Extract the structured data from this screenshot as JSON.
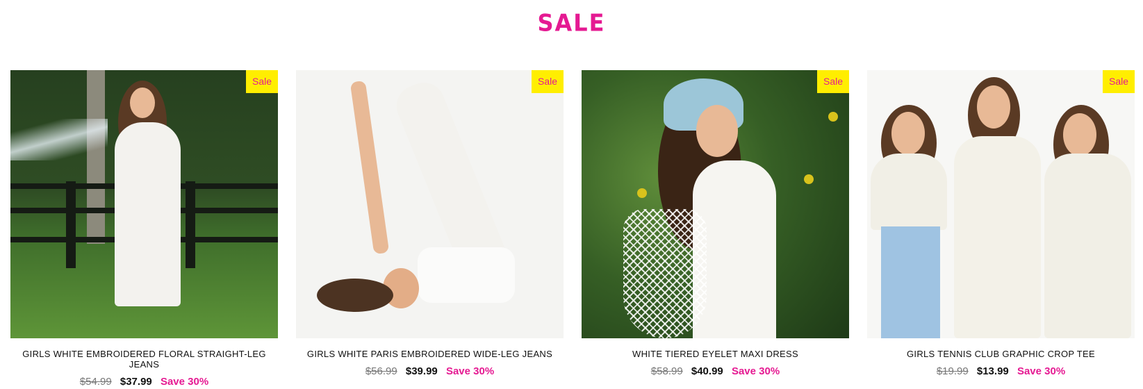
{
  "heading": "SALE",
  "products": [
    {
      "badge": "Sale",
      "name": "GIRLS WHITE EMBROIDERED FLORAL STRAIGHT-LEG JEANS",
      "old_price": "$54.99",
      "new_price": "$37.99",
      "save": "Save 30%"
    },
    {
      "badge": "Sale",
      "name": "GIRLS WHITE PARIS EMBROIDERED WIDE-LEG JEANS",
      "old_price": "$56.99",
      "new_price": "$39.99",
      "save": "Save 30%"
    },
    {
      "badge": "Sale",
      "name": "WHITE TIERED EYELET MAXI DRESS",
      "old_price": "$58.99",
      "new_price": "$40.99",
      "save": "Save 30%"
    },
    {
      "badge": "Sale",
      "name": "GIRLS TENNIS CLUB GRAPHIC CROP TEE",
      "old_price": "$19.99",
      "new_price": "$13.99",
      "save": "Save 30%"
    }
  ],
  "colors": {
    "accent": "#e51a92",
    "badge_bg": "#ffee00"
  }
}
